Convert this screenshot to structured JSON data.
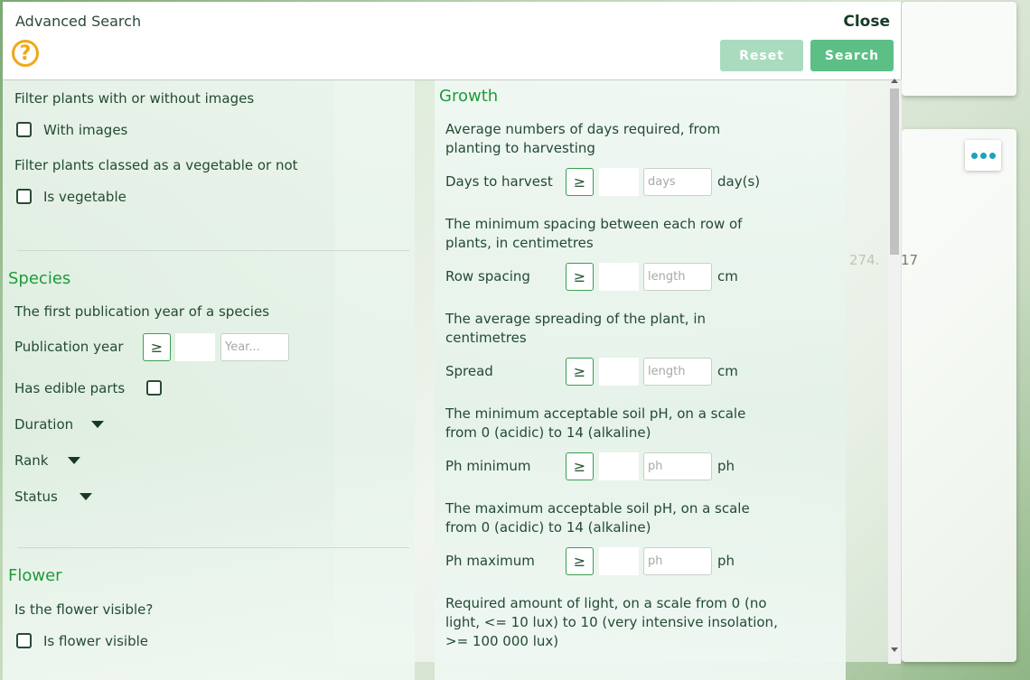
{
  "modal": {
    "title": "Advanced Search",
    "close_label": "Close",
    "help_glyph": "?",
    "reset_label": "Reset",
    "search_label": "Search"
  },
  "background": {
    "num_a": "274.",
    "num_b": "17"
  },
  "filters": {
    "images_desc": "Filter plants with or without images",
    "images_label": "With images",
    "vegetable_desc": "Filter plants classed as a vegetable or not",
    "vegetable_label": "Is vegetable"
  },
  "species": {
    "heading": "Species",
    "pub_desc": "The first publication year of a species",
    "pub_label": "Publication year",
    "pub_op": "≥",
    "pub_placeholder": "Year...",
    "edible_label": "Has edible parts",
    "duration_label": "Duration",
    "rank_label": "Rank",
    "status_label": "Status"
  },
  "flower": {
    "heading": "Flower",
    "visible_desc": "Is the flower visible?",
    "visible_label": "Is flower visible"
  },
  "growth": {
    "heading": "Growth",
    "fields": [
      {
        "desc": "Average numbers of days required, from planting to harvesting",
        "label": "Days to harvest",
        "op": "≥",
        "placeholder": "days",
        "unit": "day(s)"
      },
      {
        "desc": "The minimum spacing between each row of plants, in centimetres",
        "label": "Row spacing",
        "op": "≥",
        "placeholder": "length",
        "unit": "cm"
      },
      {
        "desc": "The average spreading of the plant, in centimetres",
        "label": "Spread",
        "op": "≥",
        "placeholder": "length",
        "unit": "cm"
      },
      {
        "desc": "The minimum acceptable soil pH, on a scale from 0 (acidic) to 14 (alkaline)",
        "label": "Ph minimum",
        "op": "≥",
        "placeholder": "ph",
        "unit": "ph"
      },
      {
        "desc": "The maximum acceptable soil pH, on a scale from 0 (acidic) to 14 (alkaline)",
        "label": "Ph maximum",
        "op": "≥",
        "placeholder": "ph",
        "unit": "ph"
      }
    ],
    "light_desc": "Required amount of light, on a scale from 0 (no light, <= 10 lux) to 10 (very intensive insolation, >= 100 000 lux)"
  }
}
